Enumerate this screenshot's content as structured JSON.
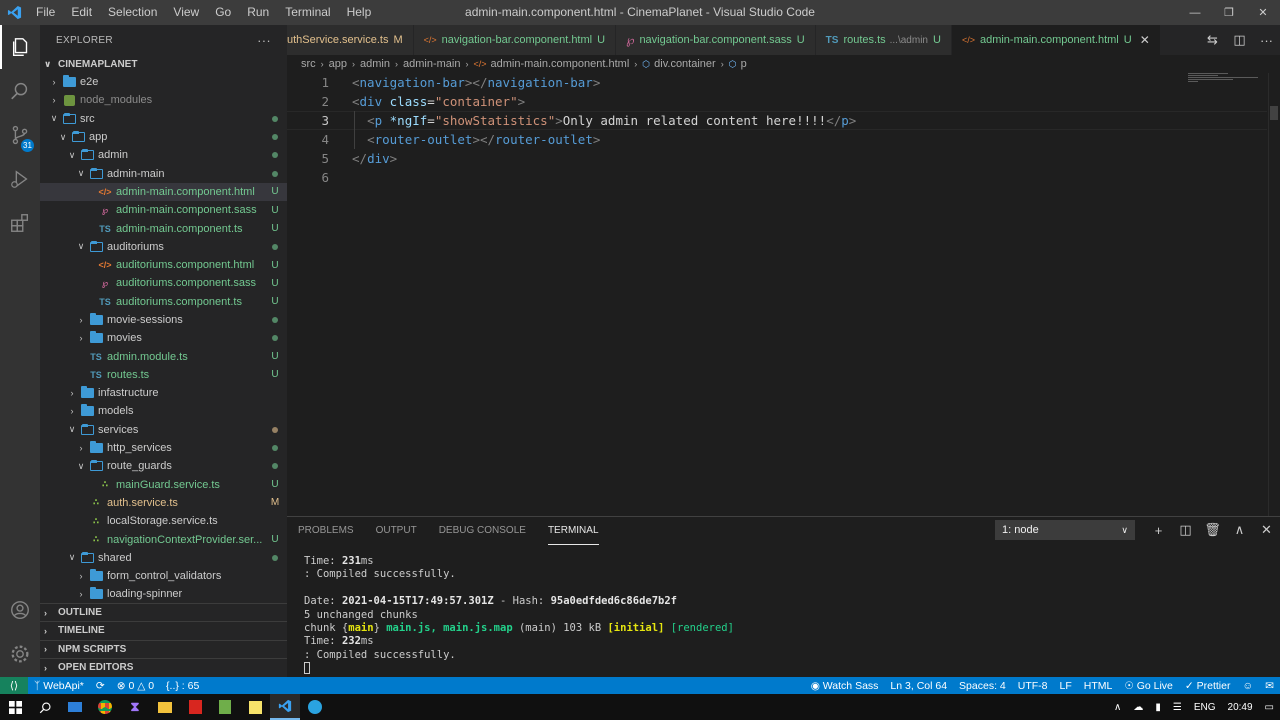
{
  "window": {
    "title": "admin-main.component.html - CinemaPlanet - Visual Studio Code",
    "menu": [
      "File",
      "Edit",
      "Selection",
      "View",
      "Go",
      "Run",
      "Terminal",
      "Help"
    ]
  },
  "activity": {
    "scm_badge": "31"
  },
  "sidebar": {
    "header": "EXPLORER",
    "more": "···",
    "workspace": "CINEMAPLANET",
    "tree": [
      {
        "label": "e2e",
        "type": "folder",
        "depth": 0,
        "open": false,
        "status": ""
      },
      {
        "label": "node_modules",
        "type": "nm",
        "depth": 0,
        "open": false,
        "status": ""
      },
      {
        "label": "src",
        "type": "folder",
        "depth": 0,
        "open": true,
        "status": "dot"
      },
      {
        "label": "app",
        "type": "folder",
        "depth": 1,
        "open": true,
        "status": "dot"
      },
      {
        "label": "admin",
        "type": "folder",
        "depth": 2,
        "open": true,
        "status": "dot"
      },
      {
        "label": "admin-main",
        "type": "folder",
        "depth": 3,
        "open": true,
        "status": "dot"
      },
      {
        "label": "admin-main.component.html",
        "type": "html",
        "depth": 4,
        "status": "U",
        "selected": true
      },
      {
        "label": "admin-main.component.sass",
        "type": "sass",
        "depth": 4,
        "status": "U"
      },
      {
        "label": "admin-main.component.ts",
        "type": "ts",
        "depth": 4,
        "status": "U"
      },
      {
        "label": "auditoriums",
        "type": "folder",
        "depth": 3,
        "open": true,
        "status": "dot"
      },
      {
        "label": "auditoriums.component.html",
        "type": "html",
        "depth": 4,
        "status": "U"
      },
      {
        "label": "auditoriums.component.sass",
        "type": "sass",
        "depth": 4,
        "status": "U"
      },
      {
        "label": "auditoriums.component.ts",
        "type": "ts",
        "depth": 4,
        "status": "U"
      },
      {
        "label": "movie-sessions",
        "type": "folder",
        "depth": 3,
        "open": false,
        "status": "dot"
      },
      {
        "label": "movies",
        "type": "folder",
        "depth": 3,
        "open": false,
        "status": "dot"
      },
      {
        "label": "admin.module.ts",
        "type": "ts",
        "depth": 3,
        "status": "U"
      },
      {
        "label": "routes.ts",
        "type": "ts",
        "depth": 3,
        "status": "U"
      },
      {
        "label": "infastructure",
        "type": "folder",
        "depth": 2,
        "open": false,
        "status": ""
      },
      {
        "label": "models",
        "type": "folder",
        "depth": 2,
        "open": false,
        "status": ""
      },
      {
        "label": "services",
        "type": "folder",
        "depth": 2,
        "open": true,
        "status": "dotm"
      },
      {
        "label": "http_services",
        "type": "folder",
        "depth": 3,
        "open": false,
        "status": "dot"
      },
      {
        "label": "route_guards",
        "type": "folder",
        "depth": 3,
        "open": true,
        "status": "dot"
      },
      {
        "label": "mainGuard.service.ts",
        "type": "svc",
        "depth": 4,
        "status": "U"
      },
      {
        "label": "auth.service.ts",
        "type": "svc",
        "depth": 3,
        "status": "M"
      },
      {
        "label": "localStorage.service.ts",
        "type": "svc",
        "depth": 3,
        "status": ""
      },
      {
        "label": "navigationContextProvider.ser...",
        "type": "svc",
        "depth": 3,
        "status": "U"
      },
      {
        "label": "shared",
        "type": "folder",
        "depth": 2,
        "open": true,
        "status": "dot"
      },
      {
        "label": "form_control_validators",
        "type": "folder",
        "depth": 3,
        "open": false,
        "status": ""
      },
      {
        "label": "loading-spinner",
        "type": "folder",
        "depth": 3,
        "open": false,
        "status": ""
      }
    ],
    "sections": [
      "OUTLINE",
      "TIMELINE",
      "NPM SCRIPTS",
      "OPEN EDITORS"
    ]
  },
  "tabs": [
    {
      "label": "uthService.service.ts",
      "status": "M",
      "icon": "svc",
      "sub": "",
      "modified": true
    },
    {
      "label": "navigation-bar.component.html",
      "status": "U",
      "icon": "html",
      "sub": ""
    },
    {
      "label": "navigation-bar.component.sass",
      "status": "U",
      "icon": "sass",
      "sub": ""
    },
    {
      "label": "routes.ts",
      "status": "U",
      "icon": "ts",
      "sub": "...\\admin"
    },
    {
      "label": "admin-main.component.html",
      "status": "U",
      "icon": "html",
      "sub": "",
      "active": true
    }
  ],
  "breadcrumb": [
    "src",
    "app",
    "admin",
    "admin-main",
    "admin-main.component.html",
    "div.container",
    "p"
  ],
  "editor": {
    "current_line": 3,
    "lines": [
      {
        "n": "1",
        "tokens": [
          [
            "br",
            "<"
          ],
          [
            "tg",
            "navigation-bar"
          ],
          [
            "br",
            "></"
          ],
          [
            "tg",
            "navigation-bar"
          ],
          [
            "br",
            ">"
          ]
        ]
      },
      {
        "n": "2",
        "tokens": [
          [
            "br",
            "<"
          ],
          [
            "tg",
            "div "
          ],
          [
            "at",
            "class"
          ],
          [
            "tx",
            "="
          ],
          [
            "sv",
            "\"container\""
          ],
          [
            "br",
            ">"
          ]
        ]
      },
      {
        "n": "3",
        "tokens": [
          [
            "tx",
            "  "
          ],
          [
            "br",
            "<"
          ],
          [
            "tg",
            "p "
          ],
          [
            "at",
            "*ngIf"
          ],
          [
            "tx",
            "="
          ],
          [
            "sv",
            "\"showStatistics\""
          ],
          [
            "br",
            ">"
          ],
          [
            "tx",
            "Only admin related content here!!!!"
          ],
          [
            "br",
            "</"
          ],
          [
            "tg",
            "p"
          ],
          [
            "br",
            ">"
          ]
        ]
      },
      {
        "n": "4",
        "tokens": [
          [
            "tx",
            "  "
          ],
          [
            "br",
            "<"
          ],
          [
            "tg",
            "router-outlet"
          ],
          [
            "br",
            "></"
          ],
          [
            "tg",
            "router-outlet"
          ],
          [
            "br",
            ">"
          ]
        ]
      },
      {
        "n": "5",
        "tokens": [
          [
            "br",
            "</"
          ],
          [
            "tg",
            "div"
          ],
          [
            "br",
            ">"
          ]
        ]
      },
      {
        "n": "6",
        "tokens": []
      }
    ]
  },
  "panel": {
    "tabs": [
      "PROBLEMS",
      "OUTPUT",
      "DEBUG CONSOLE",
      "TERMINAL"
    ],
    "active_tab": "TERMINAL",
    "terminal_select": "1: node",
    "terminal_lines": [
      [
        [
          "",
          "Time: "
        ],
        [
          "b",
          "231"
        ],
        [
          "",
          "ms"
        ]
      ],
      [
        [
          "",
          ": Compiled successfully."
        ]
      ],
      [
        [
          "",
          ""
        ]
      ],
      [
        [
          "",
          "Date: "
        ],
        [
          "b",
          "2021-04-15T17:49:57.301Z"
        ],
        [
          "",
          " - Hash: "
        ],
        [
          "b",
          "95a0edfded6c86de7b2f"
        ]
      ],
      [
        [
          "",
          "5 unchanged chunks"
        ]
      ],
      [
        [
          "",
          "chunk {"
        ],
        [
          "y",
          "main"
        ],
        [
          "",
          "} "
        ],
        [
          "g",
          "main.js, main.js.map"
        ],
        [
          "",
          " (main) 103 kB "
        ],
        [
          "y",
          "[initial]"
        ],
        [
          "",
          ""
        ],
        [
          "gn",
          " [rendered]"
        ]
      ],
      [
        [
          "",
          "Time: "
        ],
        [
          "b",
          "232"
        ],
        [
          "",
          "ms"
        ]
      ],
      [
        [
          "",
          ": Compiled successfully."
        ]
      ]
    ]
  },
  "statusbar": {
    "branch": "WebApi*",
    "errors": "0",
    "warnings": "0",
    "selection": "{..} : 65",
    "watch_sass": "Watch Sass",
    "position": "Ln 3, Col 64",
    "spaces": "Spaces: 4",
    "encoding": "UTF-8",
    "eol": "LF",
    "language": "HTML",
    "go_live": "Go Live",
    "prettier": "Prettier"
  },
  "taskbar": {
    "language": "ENG",
    "time": "20:49"
  },
  "colors": {
    "accent": "#007acc",
    "untracked": "#73c991",
    "modified": "#e2c08d"
  }
}
